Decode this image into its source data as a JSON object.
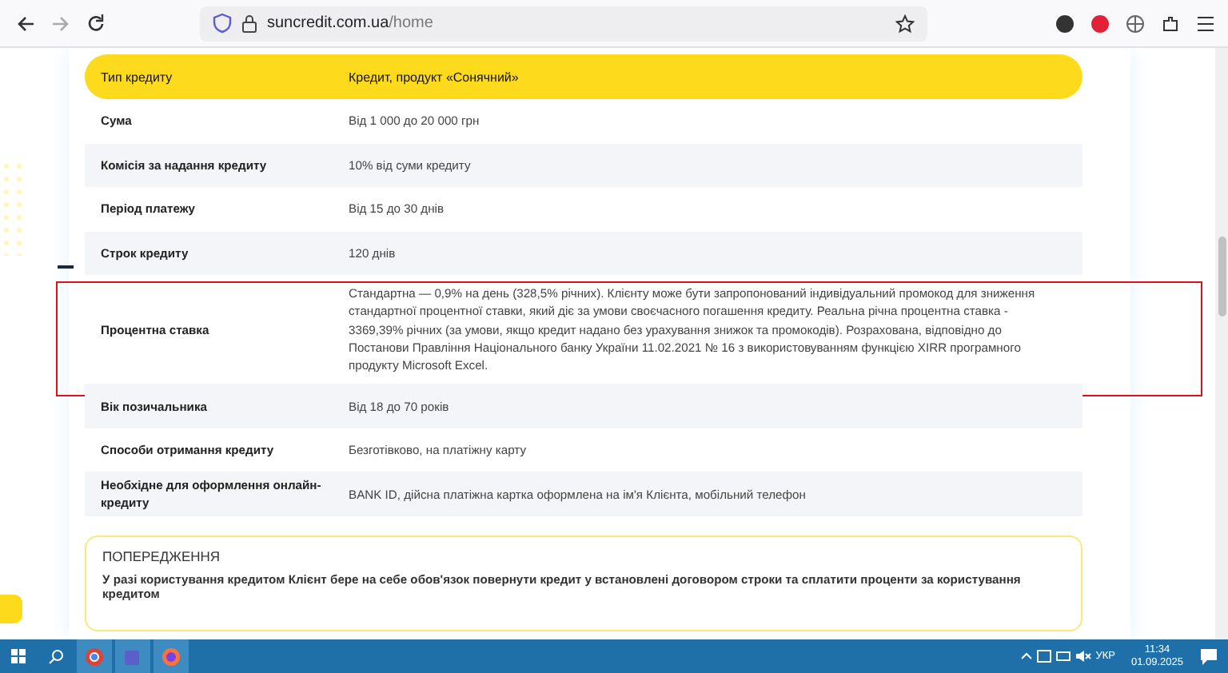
{
  "browser": {
    "url_host": "suncredit.com.ua",
    "url_path": "/home"
  },
  "table": {
    "header": [
      "Тип кредиту",
      "Кредит, продукт «Сонячний»"
    ],
    "rows": [
      {
        "label": "Сума",
        "value": "Від 1 000 до 20 000 грн",
        "highlighted": false
      },
      {
        "label": "Комісія за надання кредиту",
        "value": "10% від суми кредиту",
        "highlighted": false
      },
      {
        "label": "Період платежу",
        "value": "Від 15 до 30 днів",
        "highlighted": false
      },
      {
        "label": "Строк кредиту",
        "value": "120 днів",
        "highlighted": false
      },
      {
        "label": "Процентна ставка",
        "value": "Стандартна — 0,9% на день (328,5% річних). Клієнту може бути запропонований індивідуальний промокод для зниження стандартної процентної ставки, який діє за умови своєчасного погашення кредиту. Реальна річна процентна ставка - 3369,39% річних (за умови, якщо кредит надано без урахування знижок та промокодів). Розрахована, відповідно до Постанови Правління Національного банку України 11.02.2021 № 16 з використовуванням функцією XIRR програмного продукту Microsoft Excel.",
        "highlighted": true
      },
      {
        "label": "Вік позичальника",
        "value": "Від 18 до 70 років",
        "highlighted": false
      },
      {
        "label": "Способи отримання кредиту",
        "value": "Безготівково, на платіжну карту",
        "highlighted": false
      },
      {
        "label": "Необхідне для оформлення онлайн-кредиту",
        "value": "BANK ID, дійсна платіжна картка оформлена на ім'я Клієнта, мобільний телефон",
        "highlighted": false
      }
    ]
  },
  "warning": {
    "title": "ПОПЕРЕДЖЕННЯ",
    "text": "У разі користування кредитом Клієнт бере на себе обов'язок повернути кредит у встановлені договором строки та сплатити проценти за користування кредитом"
  },
  "taskbar": {
    "language": "УКР",
    "time": "11:34",
    "date": "01.09.2025"
  }
}
